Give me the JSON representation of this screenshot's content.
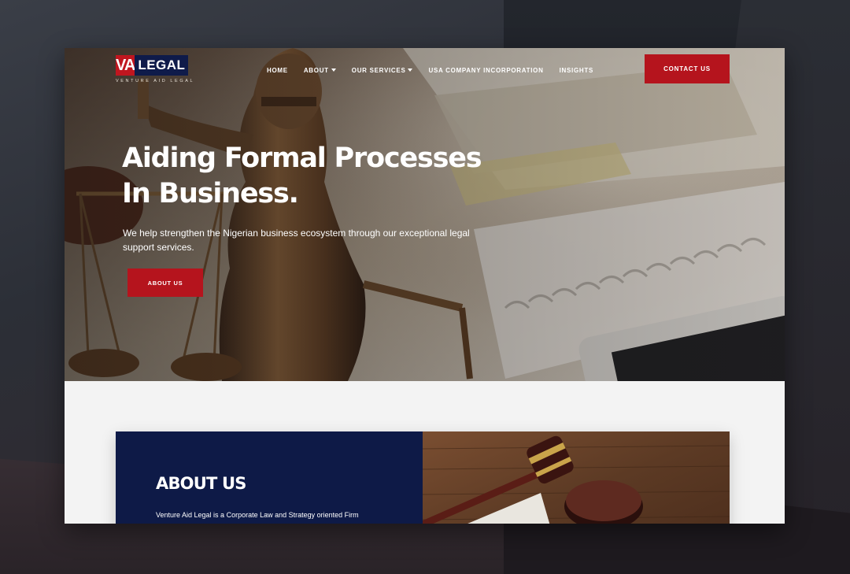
{
  "logo": {
    "mark": "VA",
    "word": "LEGAL",
    "tagline": "VENTURE AID LEGAL"
  },
  "nav": {
    "items": [
      {
        "label": "HOME",
        "has_dropdown": false
      },
      {
        "label": "ABOUT",
        "has_dropdown": true
      },
      {
        "label": "OUR SERVICES",
        "has_dropdown": true
      },
      {
        "label": "USA COMPANY INCORPORATION",
        "has_dropdown": false
      },
      {
        "label": "INSIGHTS",
        "has_dropdown": false
      }
    ],
    "contact_label": "CONTACT US"
  },
  "hero": {
    "title_line1": "Aiding Formal Processes",
    "title_line2": "In Business.",
    "text": "We help strengthen the Nigerian business ecosystem through our exceptional legal support services.",
    "button_label": "ABOUT US"
  },
  "about": {
    "title": "ABOUT US",
    "text": "Venture Aid Legal is a Corporate Law and Strategy oriented Firm"
  },
  "colors": {
    "brand_red": "#b5141d",
    "brand_navy": "#0e1a47"
  }
}
